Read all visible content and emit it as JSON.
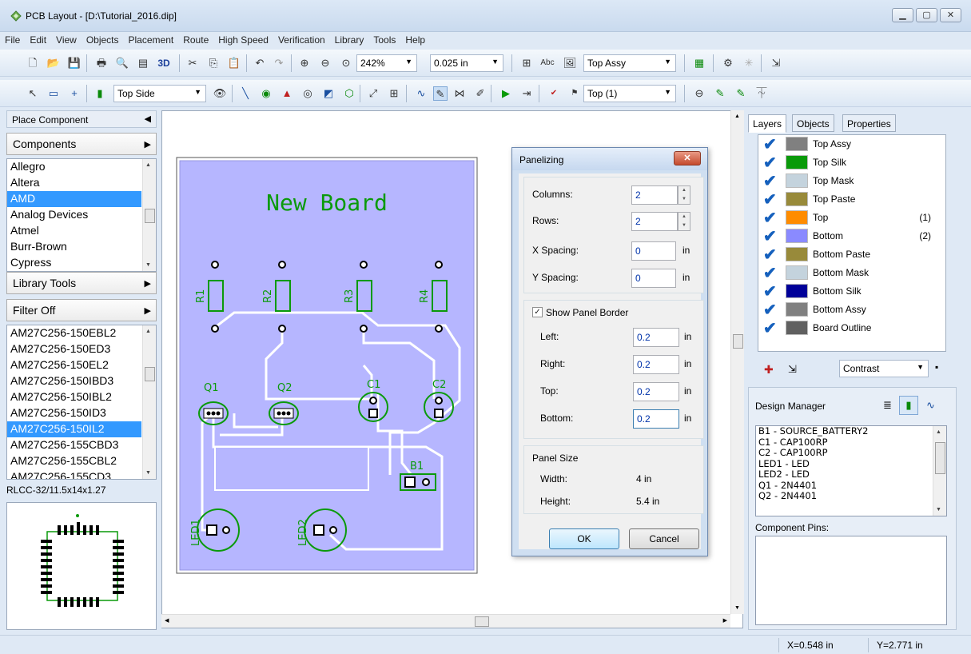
{
  "window": {
    "title": "PCB Layout - [D:\\Tutorial_2016.dip]",
    "buttons": [
      "minimize",
      "maximize",
      "close"
    ]
  },
  "menu": [
    "File",
    "Edit",
    "View",
    "Objects",
    "Placement",
    "Route",
    "High Speed",
    "Verification",
    "Library",
    "Tools",
    "Help"
  ],
  "toolbar1": {
    "zoom": "242%",
    "grid": "0.025 in",
    "layer_view": "Top Assy",
    "label_3d": "3D"
  },
  "toolbar2": {
    "side": "Top Side",
    "layer": "Top (1)"
  },
  "left_panel": {
    "header": "Place Component",
    "components_btn": "Components",
    "manufacturers": [
      "Allegro",
      "Altera",
      "AMD",
      "Analog Devices",
      "Atmel",
      "Burr-Brown",
      "Cypress"
    ],
    "selected_manufacturer": "AMD",
    "library_tools_btn": "Library Tools",
    "filter_btn": "Filter Off",
    "parts": [
      "AM27C256-150EBL2",
      "AM27C256-150ED3",
      "AM27C256-150EL2",
      "AM27C256-150IBD3",
      "AM27C256-150IBL2",
      "AM27C256-150ID3",
      "AM27C256-150IL2",
      "AM27C256-155CBD3",
      "AM27C256-155CBL2",
      "AM27C256-155CD3"
    ],
    "selected_part": "AM27C256-150IL2",
    "package": "RLCC-32/11.5x14x1.27"
  },
  "board": {
    "title": "New Board",
    "labels": [
      "R1",
      "R2",
      "R3",
      "R4",
      "Q1",
      "Q2",
      "C1",
      "C2",
      "B1",
      "LED1",
      "LED2"
    ]
  },
  "dialog": {
    "title": "Panelizing",
    "columns_label": "Columns:",
    "columns_value": "2",
    "rows_label": "Rows:",
    "rows_value": "2",
    "xspacing_label": "X Spacing:",
    "xspacing_value": "0",
    "yspacing_label": "Y Spacing:",
    "yspacing_value": "0",
    "unit": "in",
    "show_border_label": "Show Panel Border",
    "show_border_checked": true,
    "left_label": "Left:",
    "left_value": "0.2",
    "right_label": "Right:",
    "right_value": "0.2",
    "top_label": "Top:",
    "top_value": "0.2",
    "bottom_label": "Bottom:",
    "bottom_value": "0.2",
    "panel_size_label": "Panel Size",
    "width_label": "Width:",
    "width_value": "4 in",
    "height_label": "Height:",
    "height_value": "5.4 in",
    "ok_label": "OK",
    "cancel_label": "Cancel"
  },
  "right_panel": {
    "tabs": [
      "Layers",
      "Objects",
      "Properties"
    ],
    "active_tab": "Layers",
    "layers": [
      {
        "name": "Top Assy",
        "color": "#808080",
        "index": ""
      },
      {
        "name": "Top Silk",
        "color": "#0a9a0a",
        "index": ""
      },
      {
        "name": "Top Mask",
        "color": "#c4d3dd",
        "index": ""
      },
      {
        "name": "Top Paste",
        "color": "#988a3a",
        "index": ""
      },
      {
        "name": "Top",
        "color": "#ff8c00",
        "index": "(1)"
      },
      {
        "name": "Bottom",
        "color": "#8a8aff",
        "index": "(2)"
      },
      {
        "name": "Bottom Paste",
        "color": "#988a3a",
        "index": ""
      },
      {
        "name": "Bottom Mask",
        "color": "#c4d3dd",
        "index": ""
      },
      {
        "name": "Bottom Silk",
        "color": "#000099",
        "index": ""
      },
      {
        "name": "Bottom Assy",
        "color": "#808080",
        "index": ""
      },
      {
        "name": "Board Outline",
        "color": "#606060",
        "index": ""
      }
    ],
    "contrast_label": "Contrast",
    "design_manager_label": "Design Manager",
    "dm_items": [
      "B1 - SOURCE_BATTERY2",
      "C1 - CAP100RP",
      "C2 - CAP100RP",
      "LED1 - LED",
      "LED2 - LED",
      "Q1 - 2N4401",
      "Q2 - 2N4401"
    ],
    "component_pins_label": "Component Pins:"
  },
  "status": {
    "x": "X=0.548 in",
    "y": "Y=2.771 in"
  },
  "colors": {
    "board_fill": "#b6b6ff",
    "silk": "#0a9a0a",
    "trace": "#ffffff",
    "selection": "#3399ff"
  }
}
